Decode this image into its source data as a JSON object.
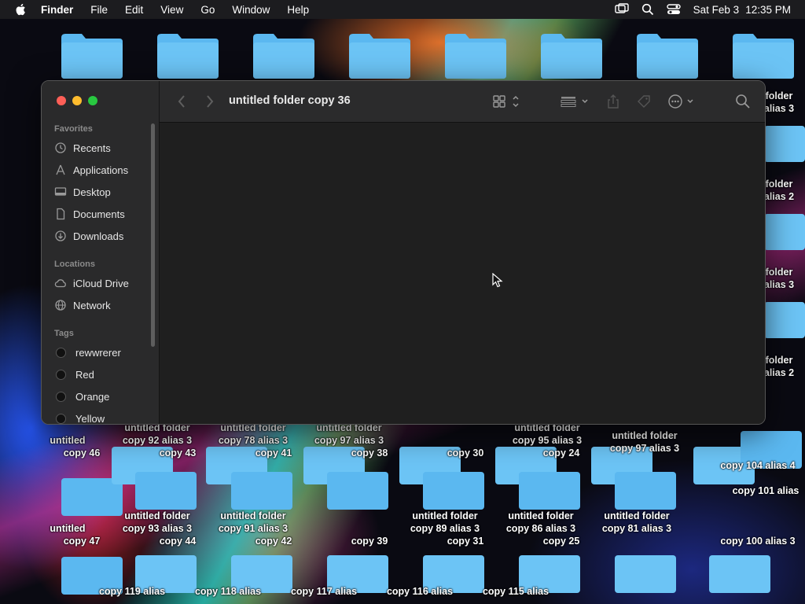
{
  "menubar": {
    "app": "Finder",
    "items": [
      "File",
      "Edit",
      "View",
      "Go",
      "Window",
      "Help"
    ],
    "date": "Sat Feb 3",
    "time": "12:35 PM"
  },
  "finder": {
    "title": "untitled folder copy 36",
    "sidebar": {
      "favorites_label": "Favorites",
      "favorites": [
        {
          "label": "Recents",
          "icon": "clock-icon"
        },
        {
          "label": "Applications",
          "icon": "applications-icon"
        },
        {
          "label": "Desktop",
          "icon": "desktop-icon"
        },
        {
          "label": "Documents",
          "icon": "document-icon"
        },
        {
          "label": "Downloads",
          "icon": "download-icon"
        }
      ],
      "locations_label": "Locations",
      "locations": [
        {
          "label": "iCloud Drive",
          "icon": "cloud-icon"
        },
        {
          "label": "Network",
          "icon": "globe-icon"
        }
      ],
      "tags_label": "Tags",
      "tags": [
        {
          "label": "rewwrerer"
        },
        {
          "label": "Red"
        },
        {
          "label": "Orange"
        },
        {
          "label": "Yellow"
        }
      ]
    }
  },
  "desktop": {
    "labels": [
      "untitled folder",
      "copy 92 alias 3",
      "untitled folder",
      "copy 78 alias 3",
      "untitled folder",
      "copy 97 alias 3",
      "untitled folder",
      "copy 95 alias 3",
      "untitled folder",
      "copy 97 alias 3",
      "untitled",
      "copy 46",
      "copy 43",
      "copy 41",
      "copy 38",
      "copy 30",
      "copy 24",
      "untitled folder",
      "copy 93 alias 3",
      "untitled folder",
      "copy 91 alias 3",
      "untitled folder",
      "copy 89 alias 3",
      "untitled folder",
      "copy 86 alias 3",
      "untitled folder",
      "copy 81 alias 3",
      "untitled",
      "copy 47",
      "copy 44",
      "copy 42",
      "copy 39",
      "copy 31",
      "copy 25",
      "copy 119 alias",
      "copy 118 alias",
      "copy 117 alias",
      "copy 116 alias",
      "copy 115 alias",
      "folder",
      "alias 3",
      "folder",
      "alias 2",
      "folder",
      "alias 3",
      "folder",
      "alias 2",
      "copy 104 alias 4",
      "copy 101 alias",
      "copy 100 alias 3"
    ]
  },
  "colors": {
    "folder": "#5bb8f0",
    "window_bg": "#1f1f1f",
    "sidebar_bg": "#2a2a2b",
    "close": "#fe5f57",
    "minimize": "#febc2e",
    "zoom": "#28c840"
  }
}
